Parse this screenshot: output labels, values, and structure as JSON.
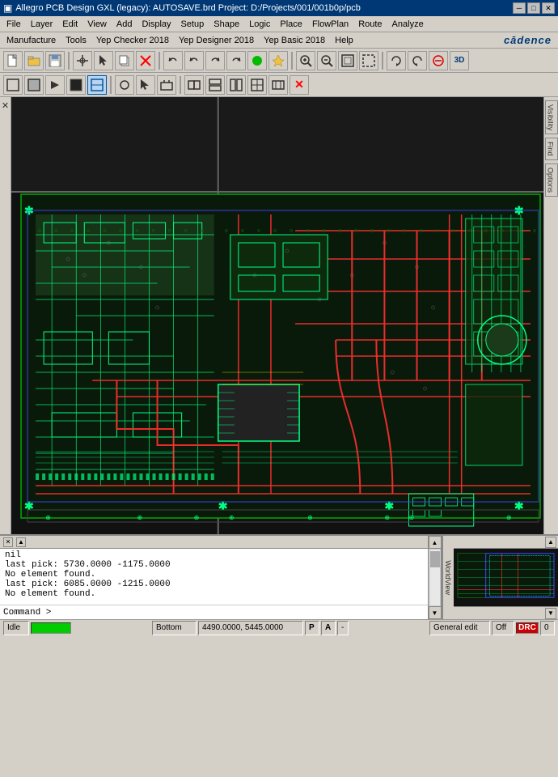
{
  "window": {
    "title": "Allegro PCB Design GXL (legacy): AUTOSAVE.brd  Project: D:/Projects/001/001b0p/pcb",
    "icon": "▣"
  },
  "titlebar": {
    "minimize": "─",
    "maximize": "□",
    "close": "✕"
  },
  "menus": {
    "bar1": [
      "File",
      "Layer",
      "Edit",
      "View",
      "Add",
      "Display",
      "Setup",
      "Shape",
      "Logic",
      "Place",
      "FlowPlan",
      "Route",
      "Analyze"
    ],
    "bar2": [
      "Manufacture",
      "Tools",
      "Yep Checker 2018",
      "Yep Designer 2018",
      "Yep Basic 2018",
      "Help"
    ]
  },
  "cadence_logo": "cādence",
  "toolbar1": {
    "buttons": [
      {
        "name": "new",
        "icon": "📄"
      },
      {
        "name": "open",
        "icon": "📂"
      },
      {
        "name": "save",
        "icon": "💾"
      },
      {
        "name": "sep1",
        "icon": "|"
      },
      {
        "name": "cross",
        "icon": "✛"
      },
      {
        "name": "pointer",
        "icon": "↖"
      },
      {
        "name": "copy",
        "icon": "⧉"
      },
      {
        "name": "delete",
        "icon": "✖"
      },
      {
        "name": "sep2",
        "icon": "|"
      },
      {
        "name": "undo",
        "icon": "↩"
      },
      {
        "name": "undo2",
        "icon": "↩"
      },
      {
        "name": "redo",
        "icon": "↪"
      },
      {
        "name": "redo2",
        "icon": "↪"
      },
      {
        "name": "circle-green",
        "icon": "●"
      },
      {
        "name": "pin",
        "icon": "📍"
      },
      {
        "name": "sep3",
        "icon": "|"
      },
      {
        "name": "grid-4",
        "icon": "⊞"
      },
      {
        "name": "grid-2",
        "icon": "⊞"
      },
      {
        "name": "grid-1",
        "icon": "⊞"
      },
      {
        "name": "grid-0",
        "icon": "⊞"
      },
      {
        "name": "sep4",
        "icon": "|"
      },
      {
        "name": "zoom-in",
        "icon": "🔍"
      },
      {
        "name": "zoom-out",
        "icon": "🔍"
      },
      {
        "name": "zoom-fit",
        "icon": "⊡"
      },
      {
        "name": "zoom-sel",
        "icon": "⊡"
      },
      {
        "name": "sep5",
        "icon": "|"
      },
      {
        "name": "refresh",
        "icon": "↻"
      },
      {
        "name": "refresh2",
        "icon": "↻"
      },
      {
        "name": "close-x",
        "icon": "⊗"
      },
      {
        "name": "3d",
        "icon": "3D"
      }
    ]
  },
  "toolbar2": {
    "buttons": [
      {
        "name": "tb2-1",
        "icon": "⬜"
      },
      {
        "name": "tb2-2",
        "icon": "⬜"
      },
      {
        "name": "tb2-3",
        "icon": "▶"
      },
      {
        "name": "tb2-4",
        "icon": "⬛"
      },
      {
        "name": "tb2-5",
        "icon": "⬜"
      },
      {
        "name": "sep",
        "icon": "|"
      },
      {
        "name": "tb2-6",
        "icon": "○"
      },
      {
        "name": "tb2-7",
        "icon": "↖"
      },
      {
        "name": "tb2-8",
        "icon": "⬜"
      },
      {
        "name": "sep2",
        "icon": "|"
      },
      {
        "name": "tb2-9",
        "icon": "⬜"
      },
      {
        "name": "tb2-10",
        "icon": "⬜"
      },
      {
        "name": "tb2-11",
        "icon": "⬜"
      },
      {
        "name": "tb2-12",
        "icon": "⬜"
      },
      {
        "name": "tb2-13",
        "icon": "⬜"
      },
      {
        "name": "tb2-14",
        "icon": "✖"
      }
    ]
  },
  "right_panel": {
    "buttons": [
      "Visibility",
      "Find",
      "Options"
    ]
  },
  "console": {
    "close_btn": "✕",
    "scroll_up": "▲",
    "scroll_down": "▼",
    "lines": [
      "nil",
      "last pick:  5730.0000 -1175.0000",
      "No element found.",
      "last pick:  6085.0000 -1215.0000",
      "No element found."
    ],
    "prompt": "Command >"
  },
  "world_view": {
    "label": "WorldView",
    "scroll_up": "▲",
    "scroll_down": "▼"
  },
  "status_bar": {
    "idle": "Idle",
    "indicator": "●",
    "bottom_layer": "Bottom",
    "coordinates": "4490.0000, 5445.0000",
    "p_btn": "P",
    "a_btn": "A",
    "dash": "-",
    "general_edit": "General edit",
    "off": "Off",
    "drc": "DRC",
    "number": "0"
  },
  "colors": {
    "green_trace": "#00ff7f",
    "red_trace": "#ff3030",
    "yellow_trace": "#ffff00",
    "board_bg": "#111111",
    "status_green": "#00cc00",
    "status_red": "#dd0000",
    "title_blue": "#003876",
    "menu_bg": "#d4d0c8"
  }
}
